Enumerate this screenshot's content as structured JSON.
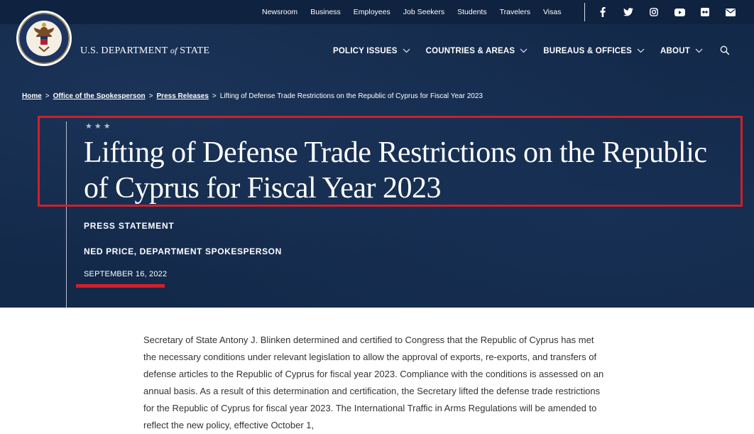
{
  "utility_nav": {
    "links": [
      "Newsroom",
      "Business",
      "Employees",
      "Job Seekers",
      "Students",
      "Travelers",
      "Visas"
    ]
  },
  "social_icons": [
    "facebook-icon",
    "twitter-icon",
    "instagram-icon",
    "youtube-icon",
    "flickr-icon",
    "email-icon"
  ],
  "site": {
    "name_part1": "U.S. DEPARTMENT ",
    "name_of": "of",
    "name_part2": " STATE"
  },
  "main_nav": [
    "POLICY ISSUES",
    "COUNTRIES & AREAS",
    "BUREAUS & OFFICES",
    "ABOUT"
  ],
  "breadcrumb": {
    "home": "Home",
    "spokesperson": "Office of the Spokesperson",
    "press_releases": "Press Releases",
    "current": "Lifting of Defense Trade Restrictions on the Republic of Cyprus for Fiscal Year 2023",
    "separator": ">"
  },
  "article": {
    "stars": "★★★",
    "title": "Lifting of Defense Trade Restrictions on the Republic of Cyprus for Fiscal Year 2023",
    "doc_type": "PRESS STATEMENT",
    "author": "NED PRICE, DEPARTMENT SPOKESPERSON",
    "date": "SEPTEMBER 16, 2022",
    "body": "Secretary of State Antony J. Blinken determined and certified to Congress that the Republic of Cyprus has met the necessary conditions under relevant legislation to allow the approval of exports, re-exports, and transfers of defense articles to the Republic of Cyprus for fiscal year 2023. Compliance with the conditions is assessed on an annual basis. As a result of this determination and certification, the Secretary lifted the defense trade restrictions for the Republic of Cyprus for fiscal year 2023. The International Traffic in Arms Regulations will be amended to reflect the new policy, effective October 1,"
  },
  "colors": {
    "hero_bg": "#13294a",
    "highlight_red": "#d11f2a",
    "body_text": "#333333"
  }
}
